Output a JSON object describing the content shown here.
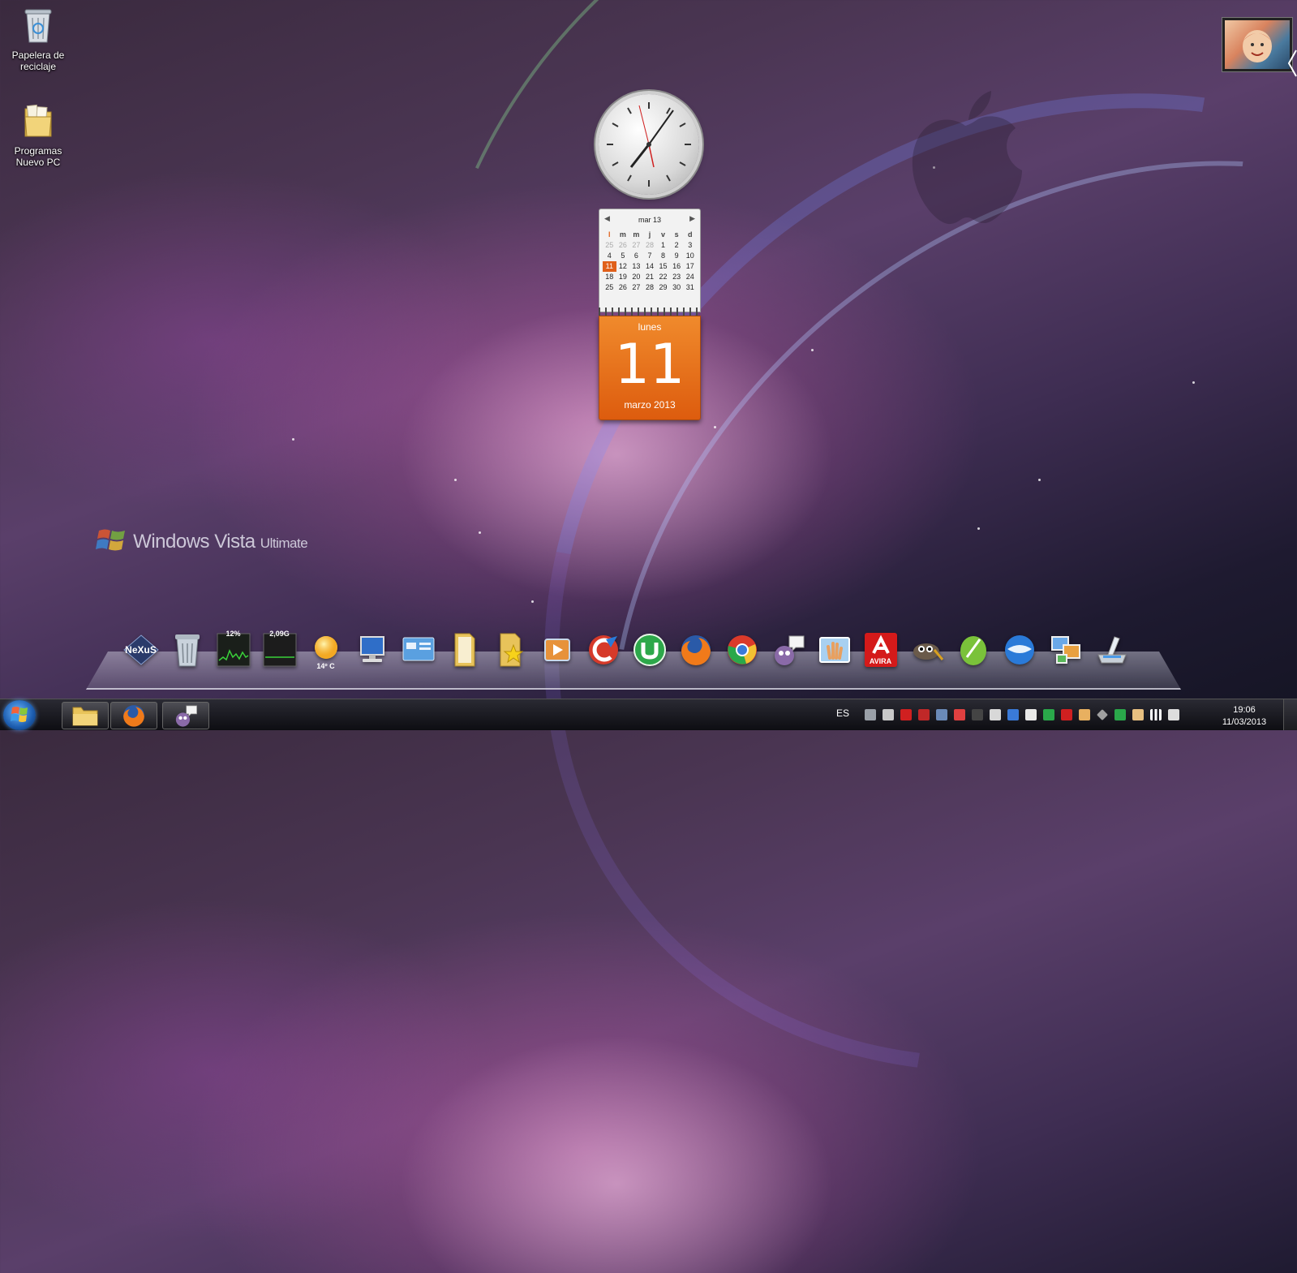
{
  "desktop": {
    "icons": [
      {
        "label": "Papelera de reciclaje",
        "icon": "recycle-bin-icon"
      },
      {
        "label": "Programas Nuevo PC",
        "icon": "folder-icon"
      }
    ],
    "watermark": {
      "brand": "Windows Vista",
      "edition": "Ultimate"
    }
  },
  "calendar_gadget": {
    "title": "mar 13",
    "weekday_headers": [
      "l",
      "m",
      "m",
      "j",
      "v",
      "s",
      "d"
    ],
    "weeks": [
      [
        "25",
        "26",
        "27",
        "28",
        "1",
        "2",
        "3"
      ],
      [
        "4",
        "5",
        "6",
        "7",
        "8",
        "9",
        "10"
      ],
      [
        "11",
        "12",
        "13",
        "14",
        "15",
        "16",
        "17"
      ],
      [
        "18",
        "19",
        "20",
        "21",
        "22",
        "23",
        "24"
      ],
      [
        "25",
        "26",
        "27",
        "28",
        "29",
        "30",
        "31"
      ]
    ],
    "today": "11",
    "weekday": "lunes",
    "day_number": "11",
    "month_year": "marzo 2013"
  },
  "dock": {
    "items": [
      {
        "icon": "nexus-icon",
        "label": "NeXuS"
      },
      {
        "icon": "trash-icon",
        "label": ""
      },
      {
        "icon": "cpu-meter-icon",
        "label": "12%"
      },
      {
        "icon": "memory-meter-icon",
        "label": "2,09G"
      },
      {
        "icon": "weather-icon",
        "label": "14º C"
      },
      {
        "icon": "computer-icon",
        "label": ""
      },
      {
        "icon": "control-panel-icon",
        "label": ""
      },
      {
        "icon": "documents-folder-icon",
        "label": ""
      },
      {
        "icon": "favorites-folder-icon",
        "label": ""
      },
      {
        "icon": "media-player-icon",
        "label": ""
      },
      {
        "icon": "ccleaner-icon",
        "label": ""
      },
      {
        "icon": "utorrent-icon",
        "label": ""
      },
      {
        "icon": "firefox-icon",
        "label": ""
      },
      {
        "icon": "chrome-icon",
        "label": ""
      },
      {
        "icon": "pidgin-icon",
        "label": ""
      },
      {
        "icon": "hand-icon",
        "label": ""
      },
      {
        "icon": "avira-icon",
        "label": "AVIRA"
      },
      {
        "icon": "gimp-icon",
        "label": ""
      },
      {
        "icon": "corel-icon",
        "label": ""
      },
      {
        "icon": "thunderbird-icon",
        "label": ""
      },
      {
        "icon": "network-icon",
        "label": ""
      },
      {
        "icon": "scanner-icon",
        "label": ""
      }
    ]
  },
  "taskbar": {
    "pinned": [
      {
        "icon": "explorer-icon"
      },
      {
        "icon": "firefox-icon"
      },
      {
        "icon": "pidgin-icon"
      }
    ],
    "language": "ES",
    "time": "19:06",
    "date": "11/03/2013",
    "colors": {
      "tray_red": "#d02020",
      "tray_green": "#2aa84a",
      "tray_blue": "#3a7ad8"
    }
  }
}
